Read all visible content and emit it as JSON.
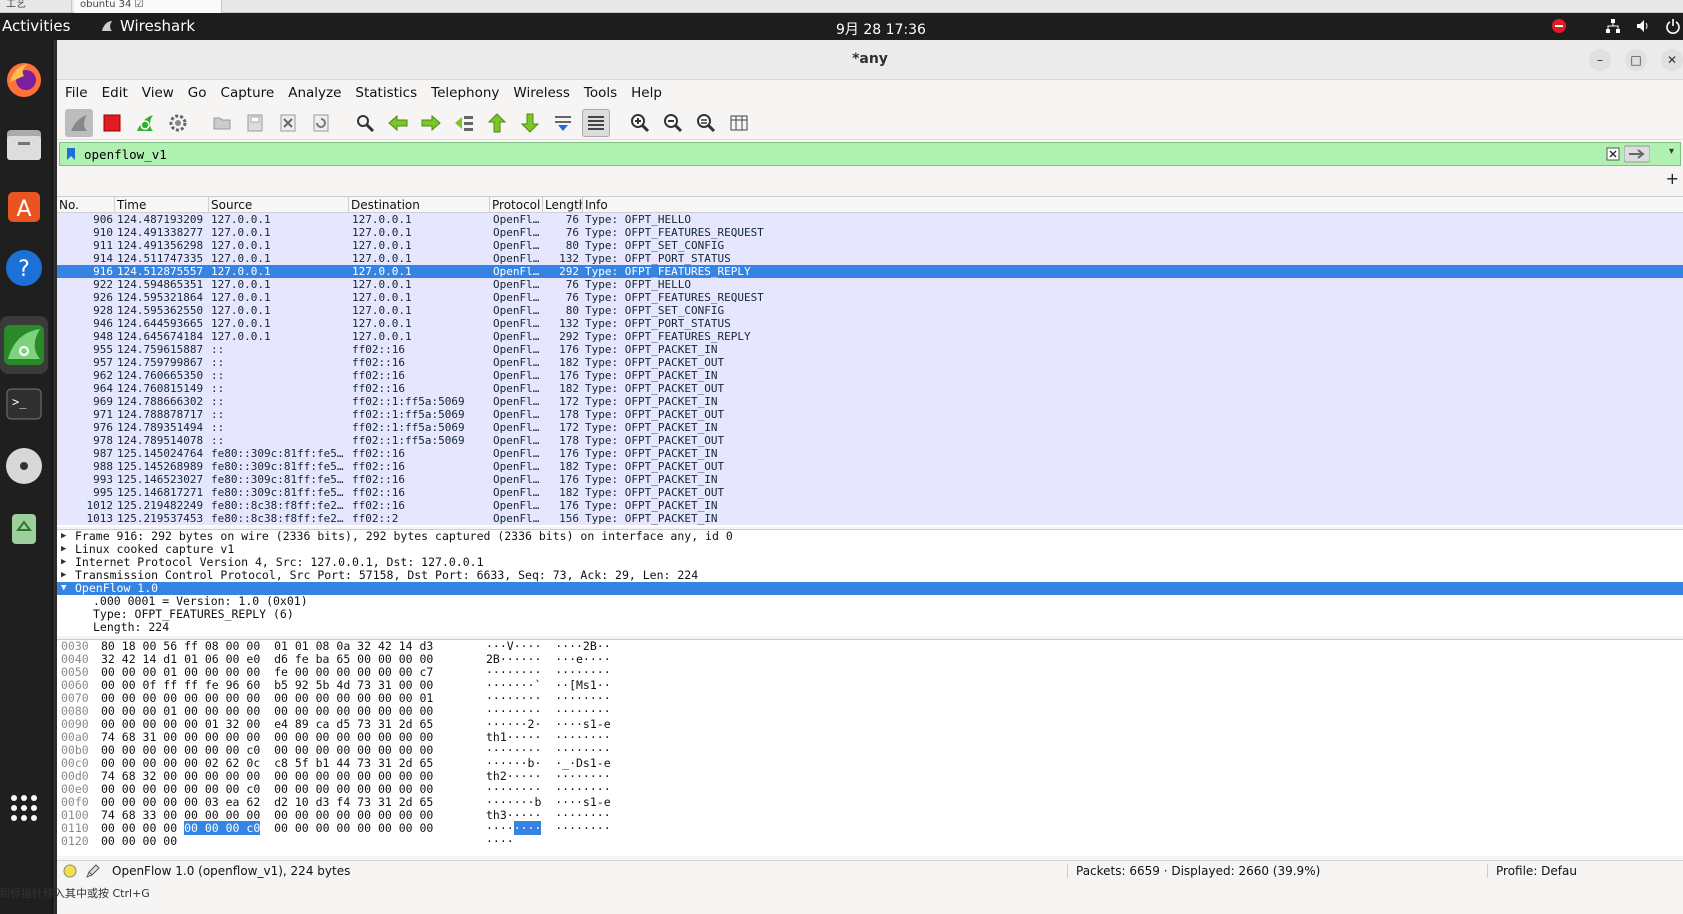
{
  "top_tabs": [
    {
      "label": "工艺"
    },
    {
      "label": "obuntu 34 ☑"
    }
  ],
  "gnome": {
    "activities": "Activities",
    "app": "Wireshark",
    "clock": "9月 28  17:36"
  },
  "window": {
    "title": "*any"
  },
  "menu": [
    "File",
    "Edit",
    "View",
    "Go",
    "Capture",
    "Analyze",
    "Statistics",
    "Telephony",
    "Wireless",
    "Tools",
    "Help"
  ],
  "filter": {
    "value": "openflow_v1"
  },
  "columns": {
    "no": "No.",
    "time": "Time",
    "source": "Source",
    "destination": "Destination",
    "protocol": "Protocol",
    "length": "Length",
    "info": "Info"
  },
  "packets": [
    {
      "no": "906",
      "time": "124.487193209",
      "src": "127.0.0.1",
      "dst": "127.0.0.1",
      "proto": "OpenFl…",
      "len": "76",
      "info": "Type: OFPT_HELLO"
    },
    {
      "no": "910",
      "time": "124.491338277",
      "src": "127.0.0.1",
      "dst": "127.0.0.1",
      "proto": "OpenFl…",
      "len": "76",
      "info": "Type: OFPT_FEATURES_REQUEST"
    },
    {
      "no": "911",
      "time": "124.491356298",
      "src": "127.0.0.1",
      "dst": "127.0.0.1",
      "proto": "OpenFl…",
      "len": "80",
      "info": "Type: OFPT_SET_CONFIG"
    },
    {
      "no": "914",
      "time": "124.511747335",
      "src": "127.0.0.1",
      "dst": "127.0.0.1",
      "proto": "OpenFl…",
      "len": "132",
      "info": "Type: OFPT_PORT_STATUS"
    },
    {
      "no": "916",
      "time": "124.512875557",
      "src": "127.0.0.1",
      "dst": "127.0.0.1",
      "proto": "OpenFl…",
      "len": "292",
      "info": "Type: OFPT_FEATURES_REPLY"
    },
    {
      "no": "922",
      "time": "124.594865351",
      "src": "127.0.0.1",
      "dst": "127.0.0.1",
      "proto": "OpenFl…",
      "len": "76",
      "info": "Type: OFPT_HELLO"
    },
    {
      "no": "926",
      "time": "124.595321864",
      "src": "127.0.0.1",
      "dst": "127.0.0.1",
      "proto": "OpenFl…",
      "len": "76",
      "info": "Type: OFPT_FEATURES_REQUEST"
    },
    {
      "no": "928",
      "time": "124.595362550",
      "src": "127.0.0.1",
      "dst": "127.0.0.1",
      "proto": "OpenFl…",
      "len": "80",
      "info": "Type: OFPT_SET_CONFIG"
    },
    {
      "no": "946",
      "time": "124.644593665",
      "src": "127.0.0.1",
      "dst": "127.0.0.1",
      "proto": "OpenFl…",
      "len": "132",
      "info": "Type: OFPT_PORT_STATUS"
    },
    {
      "no": "948",
      "time": "124.645674184",
      "src": "127.0.0.1",
      "dst": "127.0.0.1",
      "proto": "OpenFl…",
      "len": "292",
      "info": "Type: OFPT_FEATURES_REPLY"
    },
    {
      "no": "955",
      "time": "124.759615887",
      "src": "::",
      "dst": "ff02::16",
      "proto": "OpenFl…",
      "len": "176",
      "info": "Type: OFPT_PACKET_IN"
    },
    {
      "no": "957",
      "time": "124.759799867",
      "src": "::",
      "dst": "ff02::16",
      "proto": "OpenFl…",
      "len": "182",
      "info": "Type: OFPT_PACKET_OUT"
    },
    {
      "no": "962",
      "time": "124.760665350",
      "src": "::",
      "dst": "ff02::16",
      "proto": "OpenFl…",
      "len": "176",
      "info": "Type: OFPT_PACKET_IN"
    },
    {
      "no": "964",
      "time": "124.760815149",
      "src": "::",
      "dst": "ff02::16",
      "proto": "OpenFl…",
      "len": "182",
      "info": "Type: OFPT_PACKET_OUT"
    },
    {
      "no": "969",
      "time": "124.788666302",
      "src": "::",
      "dst": "ff02::1:ff5a:5069",
      "proto": "OpenFl…",
      "len": "172",
      "info": "Type: OFPT_PACKET_IN"
    },
    {
      "no": "971",
      "time": "124.788878717",
      "src": "::",
      "dst": "ff02::1:ff5a:5069",
      "proto": "OpenFl…",
      "len": "178",
      "info": "Type: OFPT_PACKET_OUT"
    },
    {
      "no": "976",
      "time": "124.789351494",
      "src": "::",
      "dst": "ff02::1:ff5a:5069",
      "proto": "OpenFl…",
      "len": "172",
      "info": "Type: OFPT_PACKET_IN"
    },
    {
      "no": "978",
      "time": "124.789514078",
      "src": "::",
      "dst": "ff02::1:ff5a:5069",
      "proto": "OpenFl…",
      "len": "178",
      "info": "Type: OFPT_PACKET_OUT"
    },
    {
      "no": "987",
      "time": "125.145024764",
      "src": "fe80::309c:81ff:fe5…",
      "dst": "ff02::16",
      "proto": "OpenFl…",
      "len": "176",
      "info": "Type: OFPT_PACKET_IN"
    },
    {
      "no": "988",
      "time": "125.145268989",
      "src": "fe80::309c:81ff:fe5…",
      "dst": "ff02::16",
      "proto": "OpenFl…",
      "len": "182",
      "info": "Type: OFPT_PACKET_OUT"
    },
    {
      "no": "993",
      "time": "125.146523027",
      "src": "fe80::309c:81ff:fe5…",
      "dst": "ff02::16",
      "proto": "OpenFl…",
      "len": "176",
      "info": "Type: OFPT_PACKET_IN"
    },
    {
      "no": "995",
      "time": "125.146817271",
      "src": "fe80::309c:81ff:fe5…",
      "dst": "ff02::16",
      "proto": "OpenFl…",
      "len": "182",
      "info": "Type: OFPT_PACKET_OUT"
    },
    {
      "no": "1012",
      "time": "125.219482249",
      "src": "fe80::8c38:f8ff:fe2…",
      "dst": "ff02::16",
      "proto": "OpenFl…",
      "len": "176",
      "info": "Type: OFPT_PACKET_IN"
    },
    {
      "no": "1013",
      "time": "125.219537453",
      "src": "fe80::8c38:f8ff:fe2…",
      "dst": "ff02::2",
      "proto": "OpenFl…",
      "len": "156",
      "info": "Type: OFPT_PACKET_IN"
    }
  ],
  "selected_packet_index": 4,
  "details": [
    {
      "text": "Frame 916: 292 bytes on wire (2336 bits), 292 bytes captured (2336 bits) on interface any, id 0",
      "expanded": false
    },
    {
      "text": "Linux cooked capture v1",
      "expanded": false
    },
    {
      "text": "Internet Protocol Version 4, Src: 127.0.0.1, Dst: 127.0.0.1",
      "expanded": false
    },
    {
      "text": "Transmission Control Protocol, Src Port: 57158, Dst Port: 6633, Seq: 73, Ack: 29, Len: 224",
      "expanded": false
    },
    {
      "text": "OpenFlow 1.0",
      "expanded": true,
      "selected": true
    }
  ],
  "detail_children": [
    ".000 0001 = Version: 1.0 (0x01)",
    "Type: OFPT_FEATURES_REPLY (6)",
    "Length: 224"
  ],
  "bytes": [
    {
      "off": "0030",
      "hex": "80 18 00 56 ff 08 00 00  01 01 08 0a 32 42 14 d3",
      "asc": "···V····  ····2B··"
    },
    {
      "off": "0040",
      "hex": "32 42 14 d1 01 06 00 e0  d6 fe ba 65 00 00 00 00",
      "asc": "2B······  ···e····"
    },
    {
      "off": "0050",
      "hex": "00 00 00 01 00 00 00 00  fe 00 00 00 00 00 00 c7",
      "asc": "········  ········"
    },
    {
      "off": "0060",
      "hex": "00 00 0f ff ff fe 96 60  b5 92 5b 4d 73 31 00 00",
      "asc": "·······`  ··[Ms1··"
    },
    {
      "off": "0070",
      "hex": "00 00 00 00 00 00 00 00  00 00 00 00 00 00 00 01",
      "asc": "········  ········"
    },
    {
      "off": "0080",
      "hex": "00 00 00 01 00 00 00 00  00 00 00 00 00 00 00 00",
      "asc": "········  ········"
    },
    {
      "off": "0090",
      "hex": "00 00 00 00 00 01 32 00  e4 89 ca d5 73 31 2d 65",
      "asc": "······2·  ····s1-e"
    },
    {
      "off": "00a0",
      "hex": "74 68 31 00 00 00 00 00  00 00 00 00 00 00 00 00",
      "asc": "th1·····  ········"
    },
    {
      "off": "00b0",
      "hex": "00 00 00 00 00 00 00 c0  00 00 00 00 00 00 00 00",
      "asc": "········  ········"
    },
    {
      "off": "00c0",
      "hex": "00 00 00 00 00 02 62 0c  c8 5f b1 44 73 31 2d 65",
      "asc": "······b·  ·_·Ds1-e"
    },
    {
      "off": "00d0",
      "hex": "74 68 32 00 00 00 00 00  00 00 00 00 00 00 00 00",
      "asc": "th2·····  ········"
    },
    {
      "off": "00e0",
      "hex": "00 00 00 00 00 00 00 c0  00 00 00 00 00 00 00 00",
      "asc": "········  ········"
    },
    {
      "off": "00f0",
      "hex": "00 00 00 00 00 03 ea 62  d2 10 d3 f4 73 31 2d 65",
      "asc": "·······b  ····s1-e"
    },
    {
      "off": "0100",
      "hex": "74 68 33 00 00 00 00 00  00 00 00 00 00 00 00 00",
      "asc": "th3·····  ········"
    },
    {
      "off": "0110",
      "hex_pre": "00 00 00 00 ",
      "hex_hl": "00 00 00 c0",
      "hex_post": "  00 00 00 00 00 00 00 00",
      "asc_pre": "····",
      "asc_hl": "····",
      "asc_post": "  ········"
    },
    {
      "off": "0120",
      "hex": "00 00 00 00",
      "asc": "····"
    }
  ],
  "status": {
    "message": "OpenFlow 1.0 (openflow_v1), 224 bytes",
    "packets": "Packets: 6659 · Displayed: 2660 (39.9%)",
    "profile": "Profile: Defau"
  },
  "bottom_text": "到标指针移入其中或按 Ctrl+G",
  "colors": {
    "row_bg": "#e7e6ff",
    "selection": "#3584e4",
    "filter_ok": "#b0f0b0"
  }
}
